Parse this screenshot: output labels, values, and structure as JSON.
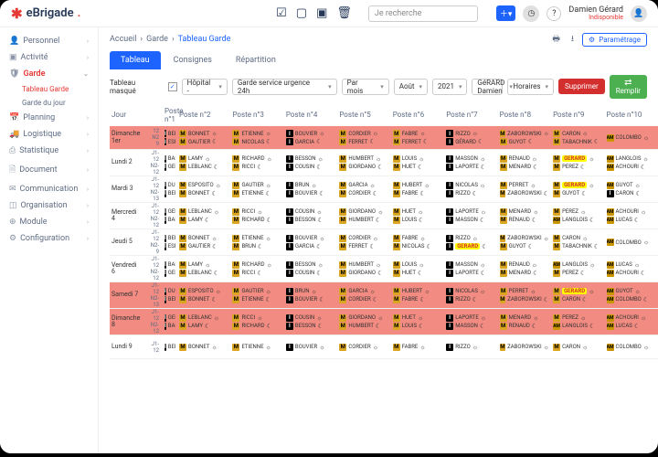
{
  "brand": "eBrigade",
  "search_placeholder": "Je recherche",
  "user": {
    "name": "Damien Gérard",
    "status": "Indisponible"
  },
  "sidebar": [
    {
      "icon": "👤",
      "label": "Personnel"
    },
    {
      "icon": "▣",
      "label": "Activité"
    },
    {
      "icon": "🛡",
      "label": "Garde",
      "active": true,
      "subs": [
        {
          "label": "Tableau Garde",
          "active": true
        },
        {
          "label": "Garde du jour"
        }
      ]
    },
    {
      "icon": "📅",
      "label": "Planning"
    },
    {
      "icon": "🚚",
      "label": "Logistique"
    },
    {
      "icon": "⎙",
      "label": "Statistique"
    },
    {
      "icon": "🗎",
      "label": "Document"
    },
    {
      "icon": "✉",
      "label": "Communication"
    },
    {
      "icon": "◫",
      "label": "Organisation"
    },
    {
      "icon": "⊕",
      "label": "Module"
    },
    {
      "icon": "⚙",
      "label": "Configuration"
    }
  ],
  "breadcrumb": [
    "Accueil",
    "Garde",
    "Tableau Garde"
  ],
  "tabs": [
    {
      "label": "Tableau",
      "active": true
    },
    {
      "label": "Consignes"
    },
    {
      "label": "Répartition"
    }
  ],
  "filters": {
    "masque": "Tableau masqué",
    "checked": true,
    "hopital": "Hôpital -",
    "service": "Garde service urgence 24h",
    "parmois": "Par mois",
    "mois": "Août",
    "annee": "2021",
    "personne": "GéRARD Damien",
    "horaires": "Horaires",
    "supprimer": "Supprimer",
    "remplir": "Remplir"
  },
  "cols": [
    "Jour",
    "Poste n°1",
    "Poste n°2",
    "Poste n°3",
    "Poste n°4",
    "Poste n°5",
    "Poste n°6",
    "Poste n°7",
    "Poste n°8",
    "Poste n°9",
    "Poste n°10"
  ],
  "param": "Paramétrage",
  "days": [
    {
      "label": "Dimanche\n1er",
      "red": true,
      "sub": [
        "12",
        "N2",
        "9"
      ],
      "cells": [
        [
          "BERTIN",
          "ESPOSITO"
        ],
        [
          "BONNET",
          "GAUTIER"
        ],
        [
          "ETIENNE",
          "NICOLAS"
        ],
        [
          "BOUVIER",
          "GARCIA"
        ],
        [
          "CORDIER",
          "FERRET"
        ],
        [
          "FABRE",
          "FERRET"
        ],
        [
          "RIZZO",
          "GÉRARD"
        ],
        [
          "ZABOROWSKI",
          "GUYOT"
        ],
        [
          "CARON",
          "TABACHNIK"
        ],
        [
          "COLOMBO",
          ""
        ]
      ],
      "hi": [
        [
          "",
          "1"
        ],
        [
          "",
          ""
        ],
        [
          "",
          ""
        ],
        [
          "",
          ""
        ],
        [
          "",
          ""
        ],
        [
          "",
          ""
        ],
        [
          "",
          "1"
        ],
        [
          "",
          ""
        ],
        [
          "",
          ""
        ],
        [
          "M",
          ""
        ]
      ]
    },
    {
      "label": "Lundi 2",
      "sub": [
        "J1-",
        "12",
        "N2-",
        "12"
      ],
      "cells": [
        [
          "BARTHELEMY",
          "GERMAIN"
        ],
        [
          "LAMY",
          "LEBLANC"
        ],
        [
          "RICHARD",
          "RICCI"
        ],
        [
          "BESSON",
          "COUSIN"
        ],
        [
          "HUMBERT",
          "GIORDANO"
        ],
        [
          "LOUIS",
          "HUET"
        ],
        [
          "MASSON",
          "LAPORTE"
        ],
        [
          "RENAUD",
          "MENARD"
        ],
        [
          "GÉRARD",
          "PEREZ"
        ],
        [
          "LANGLOIS",
          "ACHOURI"
        ]
      ],
      "hi": [
        [
          "",
          ""
        ],
        [
          "",
          ""
        ],
        [
          "",
          ""
        ],
        [
          "",
          ""
        ],
        [
          "",
          ""
        ],
        [
          "",
          ""
        ],
        [
          "",
          ""
        ],
        [
          "",
          ""
        ],
        [
          "Y",
          ""
        ],
        [
          "M",
          "M"
        ]
      ]
    },
    {
      "label": "Mardi 3",
      "sub": [
        "J1-",
        "12",
        "N2-",
        "13"
      ],
      "cells": [
        [
          "DUPONT",
          "BERTIN"
        ],
        [
          "ESPOSITO",
          "BONNET"
        ],
        [
          "GAUTIER",
          "ETIENNE"
        ],
        [
          "BRUN",
          "BOUVIER"
        ],
        [
          "GARCIA",
          "CORDIER"
        ],
        [
          "HUBERT",
          "FABRE"
        ],
        [
          "NICOLAS",
          "RIZZO"
        ],
        [
          "PERRET",
          "ZABOROWSKI"
        ],
        [
          "GÉRARD",
          "GUYOT"
        ],
        [
          "GUYOT",
          "CARON"
        ]
      ],
      "hi": [
        [
          "",
          ""
        ],
        [
          "",
          ""
        ],
        [
          "",
          ""
        ],
        [
          "",
          ""
        ],
        [
          "",
          ""
        ],
        [
          "",
          ""
        ],
        [
          "",
          ""
        ],
        [
          "",
          ""
        ],
        [
          "Y",
          ""
        ],
        [
          "M",
          ""
        ]
      ]
    },
    {
      "label": "Mercredi\n4",
      "sub": [
        "J1-",
        "12",
        "N2-",
        "12"
      ],
      "cells": [
        [
          "GERMAIN",
          "BARTHELEMY"
        ],
        [
          "LEBLANC",
          "LAMY"
        ],
        [
          "RICCI",
          "RICHARD"
        ],
        [
          "COUSIN",
          "BESSON"
        ],
        [
          "GIORDANO",
          "HUMBERT"
        ],
        [
          "HUET",
          "LOUIS"
        ],
        [
          "LAPORTE",
          "MASSON"
        ],
        [
          "MENARD",
          "RENAUD"
        ],
        [
          "PEREZ",
          "LANGLOIS"
        ],
        [
          "ACHOURI",
          "LUCAS"
        ]
      ],
      "hi": [
        [
          "",
          ""
        ],
        [
          "",
          ""
        ],
        [
          "",
          ""
        ],
        [
          "",
          ""
        ],
        [
          "",
          ""
        ],
        [
          "",
          ""
        ],
        [
          "",
          ""
        ],
        [
          "",
          ""
        ],
        [
          "",
          "M"
        ],
        [
          "M",
          "M"
        ]
      ]
    },
    {
      "label": "Jeudi 5",
      "sub": [
        "J1-",
        "12",
        "N2-",
        "9"
      ],
      "cells": [
        [
          "BERTIN",
          "ESPOSITO"
        ],
        [
          "BONNET",
          "GAUTIER"
        ],
        [
          "ETIENNE",
          "BRUN"
        ],
        [
          "BOUVIER",
          "GARCIA"
        ],
        [
          "CORDIER",
          "FERRET"
        ],
        [
          "FABRE",
          "NICOLAS"
        ],
        [
          "RIZZO",
          "GÉRARD"
        ],
        [
          "ZABOROWSKI",
          "GUYOT"
        ],
        [
          "CARON",
          "TABACHNIK"
        ],
        [
          "COLOMBO",
          ""
        ]
      ],
      "hi": [
        [
          "",
          ""
        ],
        [
          "",
          ""
        ],
        [
          "",
          ""
        ],
        [
          "",
          ""
        ],
        [
          "",
          ""
        ],
        [
          "",
          ""
        ],
        [
          "",
          "Y"
        ],
        [
          "",
          ""
        ],
        [
          "",
          ""
        ],
        [
          "M",
          ""
        ]
      ]
    },
    {
      "label": "Vendredi\n6",
      "sub": [
        "J1-",
        "12",
        "N2-",
        "12"
      ],
      "cells": [
        [
          "BARTHELEMY",
          "GERMAIN"
        ],
        [
          "LAMY",
          "LEBLANC"
        ],
        [
          "RICHARD",
          "RICCI"
        ],
        [
          "BESSON",
          "COUSIN"
        ],
        [
          "HUMBERT",
          "GIORDANO"
        ],
        [
          "LOUIS",
          "HUET"
        ],
        [
          "MASSON",
          "LAPORTE"
        ],
        [
          "RENAUD",
          "MENARD"
        ],
        [
          "LANGLOIS",
          "PEREZ"
        ],
        [
          "LUCAS",
          "ACHOURI"
        ]
      ],
      "hi": [
        [
          "",
          ""
        ],
        [
          "",
          ""
        ],
        [
          "",
          ""
        ],
        [
          "",
          ""
        ],
        [
          "",
          ""
        ],
        [
          "",
          ""
        ],
        [
          "",
          ""
        ],
        [
          "",
          ""
        ],
        [
          "M",
          ""
        ],
        [
          "M",
          "M"
        ]
      ]
    },
    {
      "label": "Samedi 7",
      "red": true,
      "sub": [
        "J1-",
        "12",
        "N2-",
        "13"
      ],
      "cells": [
        [
          "DUPONT",
          "BERTIN"
        ],
        [
          "ESPOSITO",
          "BONNET"
        ],
        [
          "GAUTIER",
          "ETIENNE"
        ],
        [
          "BRUN",
          "BOUVIER"
        ],
        [
          "GARCIA",
          "CORDIER"
        ],
        [
          "HUBERT",
          "FABRE"
        ],
        [
          "NICOLAS",
          "RIZZO"
        ],
        [
          "PERRET",
          "ZABOROWSKI"
        ],
        [
          "GÉRARD",
          "CARON"
        ],
        [
          "GUYOT",
          "COLOMBO"
        ]
      ],
      "hi": [
        [
          "",
          ""
        ],
        [
          "",
          ""
        ],
        [
          "",
          ""
        ],
        [
          "",
          ""
        ],
        [
          "",
          ""
        ],
        [
          "",
          ""
        ],
        [
          "",
          ""
        ],
        [
          "",
          ""
        ],
        [
          "Y",
          ""
        ],
        [
          "M",
          "M"
        ]
      ]
    },
    {
      "label": "Dimanche\n8",
      "red": true,
      "sub": [
        "J1-",
        "12",
        "N2-",
        "12"
      ],
      "cells": [
        [
          "GERMAIN",
          "BARTHELEMY"
        ],
        [
          "LEBLANC",
          "LAMY"
        ],
        [
          "RICCI",
          "RICHARD"
        ],
        [
          "COUSIN",
          "BESSON"
        ],
        [
          "GIORDANO",
          "HUMBERT"
        ],
        [
          "HUET",
          "LOUIS"
        ],
        [
          "LAPORTE",
          "MASSON"
        ],
        [
          "MENARD",
          "RENAUD"
        ],
        [
          "PEREZ",
          "LANGLOIS"
        ],
        [
          "ACHOURI",
          "LUCAS"
        ]
      ],
      "hi": [
        [
          "",
          ""
        ],
        [
          "",
          ""
        ],
        [
          "",
          ""
        ],
        [
          "",
          ""
        ],
        [
          "",
          ""
        ],
        [
          "",
          ""
        ],
        [
          "",
          ""
        ],
        [
          "",
          ""
        ],
        [
          "",
          "M"
        ],
        [
          "M",
          "M"
        ]
      ]
    },
    {
      "label": "Lundi 9",
      "sub": [
        "J1-",
        "12"
      ],
      "cells": [
        [
          "BERTIN",
          ""
        ],
        [
          "BONNET",
          ""
        ],
        [
          "ETIENNE",
          ""
        ],
        [
          "BOUVIER",
          ""
        ],
        [
          "CORDIER",
          ""
        ],
        [
          "FABRE",
          ""
        ],
        [
          "RIZZO",
          ""
        ],
        [
          "ZABOROWSKI",
          ""
        ],
        [
          "CARON",
          ""
        ],
        [
          "COLOMBO",
          ""
        ]
      ],
      "hi": [
        [
          "",
          ""
        ],
        [
          "",
          ""
        ],
        [
          "",
          ""
        ],
        [
          "",
          ""
        ],
        [
          "",
          ""
        ],
        [
          "",
          ""
        ],
        [
          "",
          ""
        ],
        [
          "",
          ""
        ],
        [
          "",
          ""
        ],
        [
          "M",
          ""
        ]
      ]
    }
  ]
}
